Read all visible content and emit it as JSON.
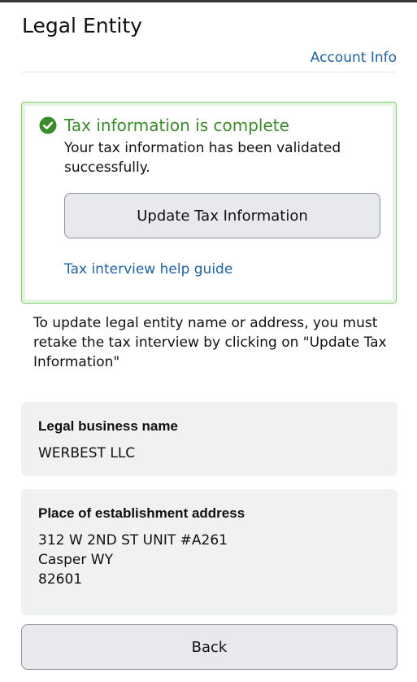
{
  "header": {
    "title": "Legal Entity",
    "account_info_link": "Account Info"
  },
  "alert": {
    "status": "success",
    "icon": "check-circle-icon",
    "heading": "Tax information is complete",
    "message": "Your tax information has been validated successfully.",
    "update_button_label": "Update Tax Information",
    "help_link": "Tax interview help guide"
  },
  "note": "To update legal entity name or address, you must retake the tax interview by clicking on \"Update Tax Information\"",
  "business": {
    "label": "Legal business name",
    "value": "WERBEST LLC"
  },
  "address": {
    "label": "Place of establishment address",
    "line1": "312 W 2ND ST UNIT #A261",
    "line2": "Casper WY",
    "line3": "82601"
  },
  "footer": {
    "back_button_label": "Back"
  },
  "colors": {
    "success_green": "#3b8a2b",
    "link_blue": "#2162a1",
    "card_gray": "#f0f2f2"
  }
}
